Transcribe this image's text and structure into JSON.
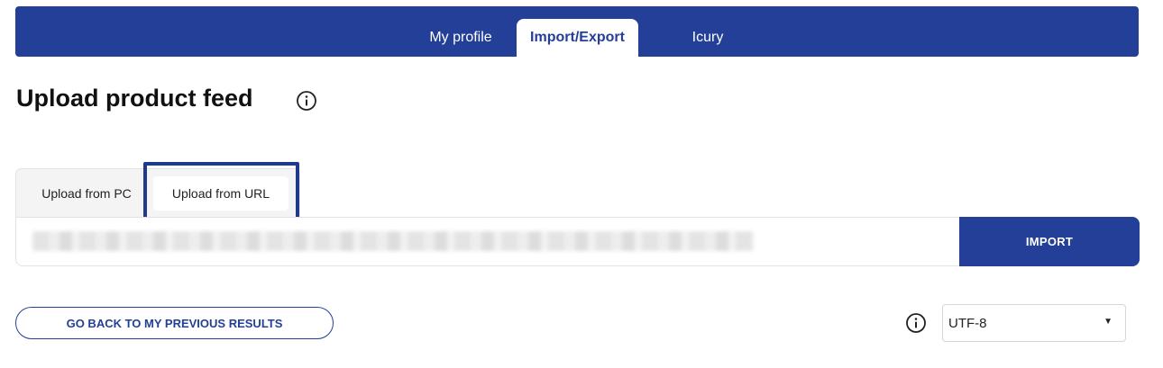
{
  "nav": {
    "tabs": [
      {
        "label": "My profile"
      },
      {
        "label": "Import/Export"
      },
      {
        "label": "Icury"
      }
    ]
  },
  "page": {
    "title": "Upload product feed"
  },
  "source_tabs": [
    {
      "label": "Upload from PC"
    },
    {
      "label": "Upload from URL"
    }
  ],
  "url_input": {
    "value": "",
    "placeholder": ""
  },
  "actions": {
    "import_label": "IMPORT",
    "back_label": "GO BACK TO MY PREVIOUS RESULTS"
  },
  "encoding": {
    "selected": "UTF-8"
  },
  "icons": {
    "title_info": "info-icon",
    "encoding_info": "info-icon",
    "select_caret": "caret-down-icon"
  },
  "colors": {
    "brand": "#233f98",
    "highlight": "#1f3a8c"
  }
}
